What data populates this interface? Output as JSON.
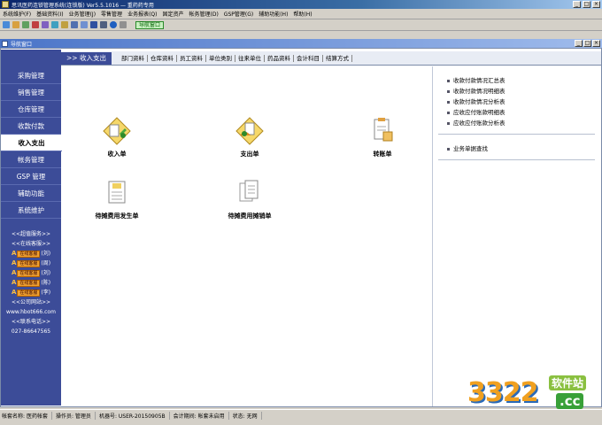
{
  "window": {
    "title": "思讯医药连锁管理系统(连锁版) Ver5.5.1016 — 重药药专用",
    "inner_title": "导航窗口"
  },
  "menu": [
    "系统维护(F)",
    "基础资料(I)",
    "业务管理(J)",
    "零售管理",
    "业务报表(Q)",
    "固定资产",
    "帐务管理(D)",
    "GSP管理(G)",
    "辅助功能(H)",
    "帮助(H)"
  ],
  "toolbar": {
    "return_label": "导航窗口"
  },
  "sidebar": {
    "items": [
      {
        "label": "采购管理"
      },
      {
        "label": "销售管理"
      },
      {
        "label": "仓库管理"
      },
      {
        "label": "收款付款"
      },
      {
        "label": "收入支出",
        "active": true
      },
      {
        "label": "帐务管理"
      },
      {
        "label": "GSP 管理"
      },
      {
        "label": "辅助功能"
      },
      {
        "label": "系统维护"
      }
    ],
    "links": {
      "tech": "<<超值服务>>",
      "online": "<<在线客服>>",
      "qq": [
        {
          "badge": "在线客服",
          "name": "(刘)"
        },
        {
          "badge": "在线客服",
          "name": "(周)"
        },
        {
          "badge": "在线客服",
          "name": "(刘)"
        },
        {
          "badge": "在线客服",
          "name": "(陈)"
        },
        {
          "badge": "在线客服",
          "name": "(李)"
        }
      ],
      "company_site": "<<公司网站>>",
      "url": "www.hbot666.com",
      "contact": "<<联系电话>>",
      "phone": "027-86647565"
    }
  },
  "tabstrip": {
    "active": ">> 收入支出",
    "tabs": [
      "部门资料",
      "仓库资料",
      "员工资料",
      "单位类别",
      "往来单位",
      "药品资料",
      "会计科目",
      "结算方式"
    ]
  },
  "tiles": [
    {
      "label": "收入单",
      "icon": "income-document-icon"
    },
    {
      "label": "支出单",
      "icon": "expense-document-icon"
    },
    {
      "label": "转账单",
      "icon": "transfer-document-icon"
    },
    {
      "label": "待摊费用发生单",
      "icon": "deferred-expense-icon"
    },
    {
      "label": "待摊费用摊销单",
      "icon": "amortization-icon"
    }
  ],
  "right_panel": {
    "group1": [
      "收款付款情况汇总表",
      "收款付款情况明细表",
      "收款付款情况分析表",
      "应收应付账款明细表",
      "应收应付账款分析表"
    ],
    "group2": [
      "业务单据查找"
    ]
  },
  "statusbar": {
    "account_label": "帐套名称:",
    "account": "医药帐套",
    "operator_label": "操作员:",
    "operator": "管理员",
    "machine_label": "机器号:",
    "machine": "USER-20150905B",
    "period_label": "会计期间:",
    "period": "帐套未启用",
    "state_label": "状态:",
    "state": "无网"
  },
  "watermark": {
    "number": "3322",
    "cn": "软件站",
    "cc": ".cc"
  },
  "colors": {
    "sidebar": "#3c4c98",
    "accent": "#f0a020"
  }
}
